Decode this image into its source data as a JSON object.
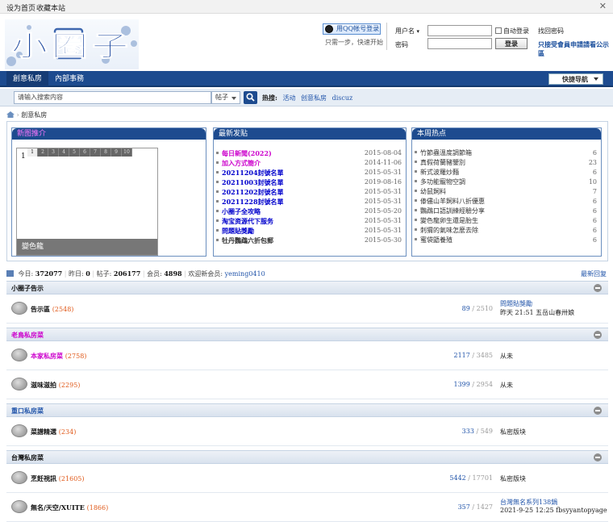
{
  "topbar": {
    "set_home": "设为首页",
    "bookmark": "收藏本站",
    "close": "✕"
  },
  "logo": {
    "text": "小圈子"
  },
  "qq_login": {
    "label": "用QQ帐号登录",
    "sub": "只需一步，快速开始"
  },
  "login": {
    "username_label": "用户名",
    "password_label": "密码",
    "auto_login": "自动登录",
    "find_password": "找回密码",
    "login_button": "登录",
    "notice": "只接受會員申請請看公示區"
  },
  "nav": {
    "tabs": [
      "創意私房",
      "內部事務"
    ],
    "quick_nav": "快捷导航"
  },
  "search": {
    "placeholder": "请输入搜索内容",
    "type": "帖子",
    "hot_label": "热搜:",
    "hot_keywords": [
      "活动",
      "创意私房",
      "discuz"
    ]
  },
  "breadcrumb": {
    "current": "創意私房"
  },
  "boxes": {
    "new_members": {
      "title": "新图推介",
      "slide_number": "1",
      "pages": [
        "1",
        "2",
        "3",
        "4",
        "5",
        "6",
        "7",
        "8",
        "9",
        "10"
      ],
      "caption": "變色龍"
    },
    "latest_posts": {
      "title": "最新发贴",
      "items": [
        {
          "title": "每日新聞(2022)",
          "date": "2015-08-04",
          "color": "#cc00cc"
        },
        {
          "title": "加入方式簡介",
          "date": "2014-11-06",
          "color": "#cc00cc"
        },
        {
          "title": "20211204封號名單",
          "date": "2015-05-31",
          "color": "#0000cc"
        },
        {
          "title": "20211003封號名單",
          "date": "2019-08-16",
          "color": "#0000cc"
        },
        {
          "title": "20211202封號名單",
          "date": "2015-05-31",
          "color": "#0000cc"
        },
        {
          "title": "20211228封號名單",
          "date": "2015-05-31",
          "color": "#0000cc"
        },
        {
          "title": "小圈子全攻略",
          "date": "2015-05-20",
          "color": "#0000cc"
        },
        {
          "title": "淘宝资源代下服务",
          "date": "2015-05-31",
          "color": "#0000cc"
        },
        {
          "title": "問題貼獎勵",
          "date": "2015-05-31",
          "color": "#0000cc"
        },
        {
          "title": "牡丹鸚鵡六折包郵",
          "date": "2015-05-30",
          "color": "#333333"
        }
      ]
    },
    "weekly_hot": {
      "title": "本周热点",
      "items": [
        {
          "title": "竹節蟲溫度調節箱",
          "count": "6"
        },
        {
          "title": "真假荷蘭豬鑒別",
          "count": "23"
        },
        {
          "title": "新式波羅炒麵",
          "count": "6"
        },
        {
          "title": "多功能寵物空調",
          "count": "10"
        },
        {
          "title": "幼鼠飼料",
          "count": "7"
        },
        {
          "title": "傣儘山羊飼料八折優惠",
          "count": "6"
        },
        {
          "title": "鸚鵡口語訓練經驗分享",
          "count": "6"
        },
        {
          "title": "變色龍卵生還是胎生",
          "count": "6"
        },
        {
          "title": "刺猬的氣味怎麼去除",
          "count": "6"
        },
        {
          "title": "蜜袋鼯養殖",
          "count": "6"
        }
      ]
    }
  },
  "stats": {
    "today_label": "今日:",
    "today": "372077",
    "yesterday_label": "昨日:",
    "yesterday": "0",
    "posts_label": "帖子:",
    "posts": "206177",
    "members_label": "会员:",
    "members": "4898",
    "welcome_label": "欢迎新会员:",
    "new_member": "yeming0410",
    "latest_reply": "最新回复"
  },
  "categories": [
    {
      "title": "小圈子告示",
      "color": "#111111",
      "forums": [
        {
          "name": "告示區",
          "count": "(2548)",
          "threads": "89",
          "posts": "2510",
          "last_title": "問題貼獎勵",
          "last_info": "昨天 21:51 五岳山春卅娘"
        }
      ]
    },
    {
      "title": "老鳥私房菜",
      "color": "#cc00cc",
      "forums": [
        {
          "name": "本家私房菜",
          "count": "(2758)",
          "threads": "2117",
          "posts": "3485",
          "last_title": "",
          "last_info": "从未",
          "name_color": "#cc00cc"
        },
        {
          "name": "滋味滋拍",
          "count": "(2295)",
          "threads": "1399",
          "posts": "2954",
          "last_title": "",
          "last_info": "从未"
        }
      ]
    },
    {
      "title": "重口私房菜",
      "color": "#2255aa",
      "forums": [
        {
          "name": "菜譜精選",
          "count": "(234)",
          "threads": "333",
          "posts": "549",
          "last_title": "",
          "last_info": "私密版块"
        }
      ]
    },
    {
      "title": "台灣私房菜",
      "color": "#111111",
      "forums": [
        {
          "name": "烹飪視訊",
          "count": "(21605)",
          "threads": "5442",
          "posts": "17701",
          "last_title": "",
          "last_info": "私密版块"
        },
        {
          "name": "無名/天空/XUITE",
          "count": "(1866)",
          "threads": "357",
          "posts": "1427",
          "last_title": "台灣無名系列138鍋",
          "last_info": "2021-9-25 12:25 fbsyyantopyage"
        }
      ]
    }
  ]
}
